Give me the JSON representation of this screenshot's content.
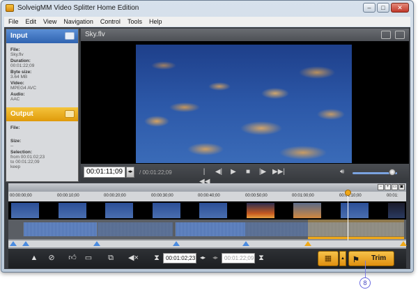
{
  "window": {
    "title": "SolveigMM Video Splitter Home Edition"
  },
  "menu": [
    "File",
    "Edit",
    "View",
    "Navigation",
    "Control",
    "Tools",
    "Help"
  ],
  "input": {
    "title": "Input",
    "file_label": "File:",
    "file_value": "Sky.flv",
    "duration_label": "Duration:",
    "duration_value": "00:01:22;09",
    "bytesize_label": "Byte size:",
    "bytesize_value": "3.64 MB",
    "video_label": "Video:",
    "video_value": "MPEG4 AVC",
    "audio_label": "Audio:",
    "audio_value": "AAC"
  },
  "output": {
    "title": "Output",
    "file_label": "File:",
    "file_value": "",
    "size_label": "Size:",
    "size_value": "--",
    "selection_label": "Selection:",
    "from_value": "from 00:01:02;23",
    "to_value": "to      00:01:22;09",
    "keep_value": "keep"
  },
  "player": {
    "filename": "Sky.flv",
    "current_time": "00:01:11;09",
    "total_time": "/ 00:01:22;09",
    "volume": 0.82
  },
  "timeline": {
    "ticks": [
      "00:00:00;00",
      "00:00:10;00",
      "00:00:20;00",
      "00:00:30;00",
      "00:00:40;00",
      "00:00:50;00",
      "00:01:00;00",
      "00:01:10;00",
      "00:01:"
    ]
  },
  "toolbar": {
    "start_time": "00:01:02;23",
    "end_time": "00:01:22;09",
    "trim_label": "Trim"
  },
  "callout": {
    "label": "8"
  }
}
